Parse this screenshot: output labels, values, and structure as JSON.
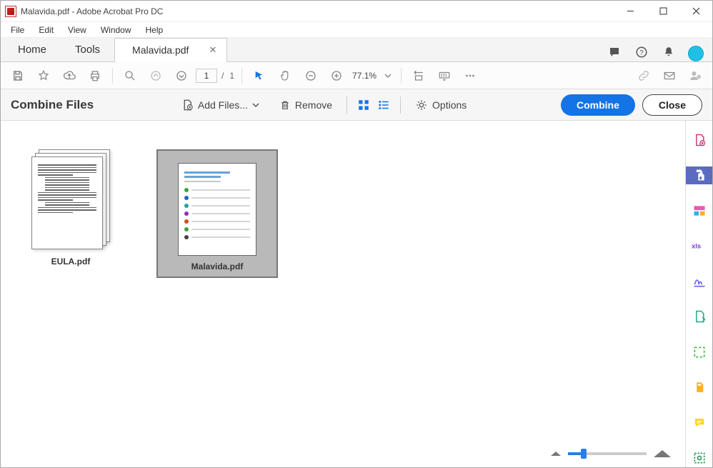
{
  "window": {
    "title": "Malavida.pdf - Adobe Acrobat Pro DC"
  },
  "menu": {
    "file": "File",
    "edit": "Edit",
    "view": "View",
    "window": "Window",
    "help": "Help"
  },
  "tabs": {
    "home": "Home",
    "tools": "Tools",
    "file": "Malavida.pdf"
  },
  "toolbar": {
    "page_current": "1",
    "page_total": "1",
    "page_sep": "/",
    "zoom": "77.1%"
  },
  "combine": {
    "title": "Combine Files",
    "add_files": "Add Files...",
    "remove": "Remove",
    "options": "Options",
    "combine": "Combine",
    "close": "Close"
  },
  "files": {
    "0": {
      "name": "EULA.pdf"
    },
    "1": {
      "name": "Malavida.pdf"
    }
  }
}
